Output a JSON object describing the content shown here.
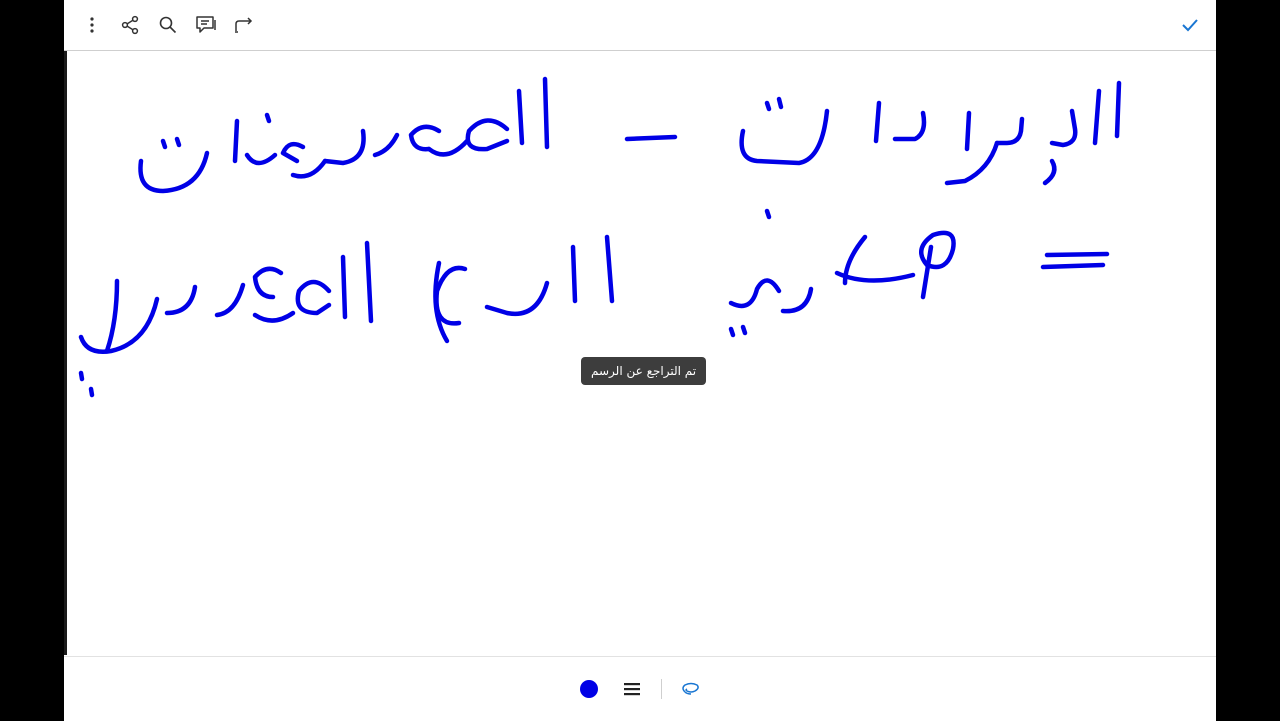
{
  "toolbar": {
    "icons": [
      "more-vertical-icon",
      "share-icon",
      "search-icon",
      "comment-icon",
      "redo-icon",
      "checkmark-icon"
    ]
  },
  "toast": {
    "text": "تم التراجع عن الرسم"
  },
  "drawing": {
    "ink_color": "#0000e6",
    "line1": "الإيرادات - المصروفات",
    "line2": "= صافي الربح المحاسبي"
  },
  "bottom_toolbar": {
    "pen_color": "#0000e6",
    "tools": [
      "pen-color-icon",
      "stroke-width-icon",
      "lasso-icon"
    ]
  },
  "colors": {
    "accent": "#1976d2",
    "ink": "#0000e6",
    "toast_bg": "#3d3d3d"
  }
}
